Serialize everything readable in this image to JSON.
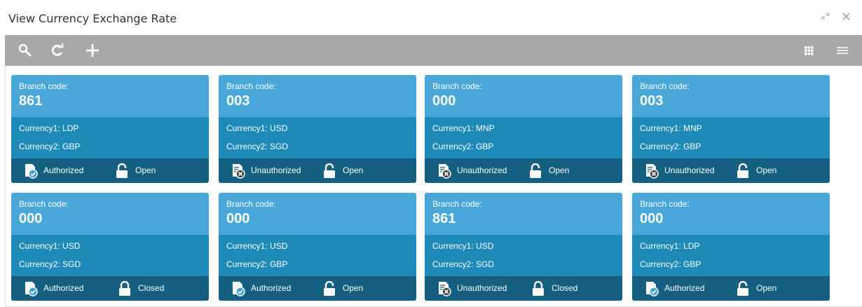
{
  "window": {
    "title": "View Currency Exchange Rate"
  },
  "toolbar": {
    "icons": [
      "search-icon",
      "refresh-icon",
      "add-icon",
      "grid-view-icon",
      "list-view-icon"
    ]
  },
  "tiles": [
    {
      "branch_label": "Branch code:",
      "branch_code": "861",
      "currency1": "Currency1: LDP",
      "currency2": "Currency2: GBP",
      "auth_status": "Authorized",
      "record_status": "Open"
    },
    {
      "branch_label": "Branch code:",
      "branch_code": "003",
      "currency1": "Currency1: USD",
      "currency2": "Currency2: SGD",
      "auth_status": "Unauthorized",
      "record_status": "Open"
    },
    {
      "branch_label": "Branch code:",
      "branch_code": "000",
      "currency1": "Currency1: MNP",
      "currency2": "Currency2: GBP",
      "auth_status": "Unauthorized",
      "record_status": "Open"
    },
    {
      "branch_label": "Branch code:",
      "branch_code": "003",
      "currency1": "Currency1: MNP",
      "currency2": "Currency2: GBP",
      "auth_status": "Unauthorized",
      "record_status": "Open"
    },
    {
      "branch_label": "Branch code:",
      "branch_code": "000",
      "currency1": "Currency1: USD",
      "currency2": "Currency2: SGD",
      "auth_status": "Authorized",
      "record_status": "Closed"
    },
    {
      "branch_label": "Branch code:",
      "branch_code": "000",
      "currency1": "Currency1: USD",
      "currency2": "Currency2: GBP",
      "auth_status": "Authorized",
      "record_status": "Open"
    },
    {
      "branch_label": "Branch code:",
      "branch_code": "861",
      "currency1": "Currency1: USD",
      "currency2": "Currency2: SGD",
      "auth_status": "Unauthorized",
      "record_status": "Closed"
    },
    {
      "branch_label": "Branch code:",
      "branch_code": "000",
      "currency1": "Currency1: LDP",
      "currency2": "Currency2: GBP",
      "auth_status": "Authorized",
      "record_status": "Open"
    }
  ],
  "colors": {
    "toolbar_bg": "#a8a8a8",
    "tile_top": "#4aa8d8",
    "tile_mid": "#1e8ab8",
    "tile_bottom": "#155f80"
  }
}
